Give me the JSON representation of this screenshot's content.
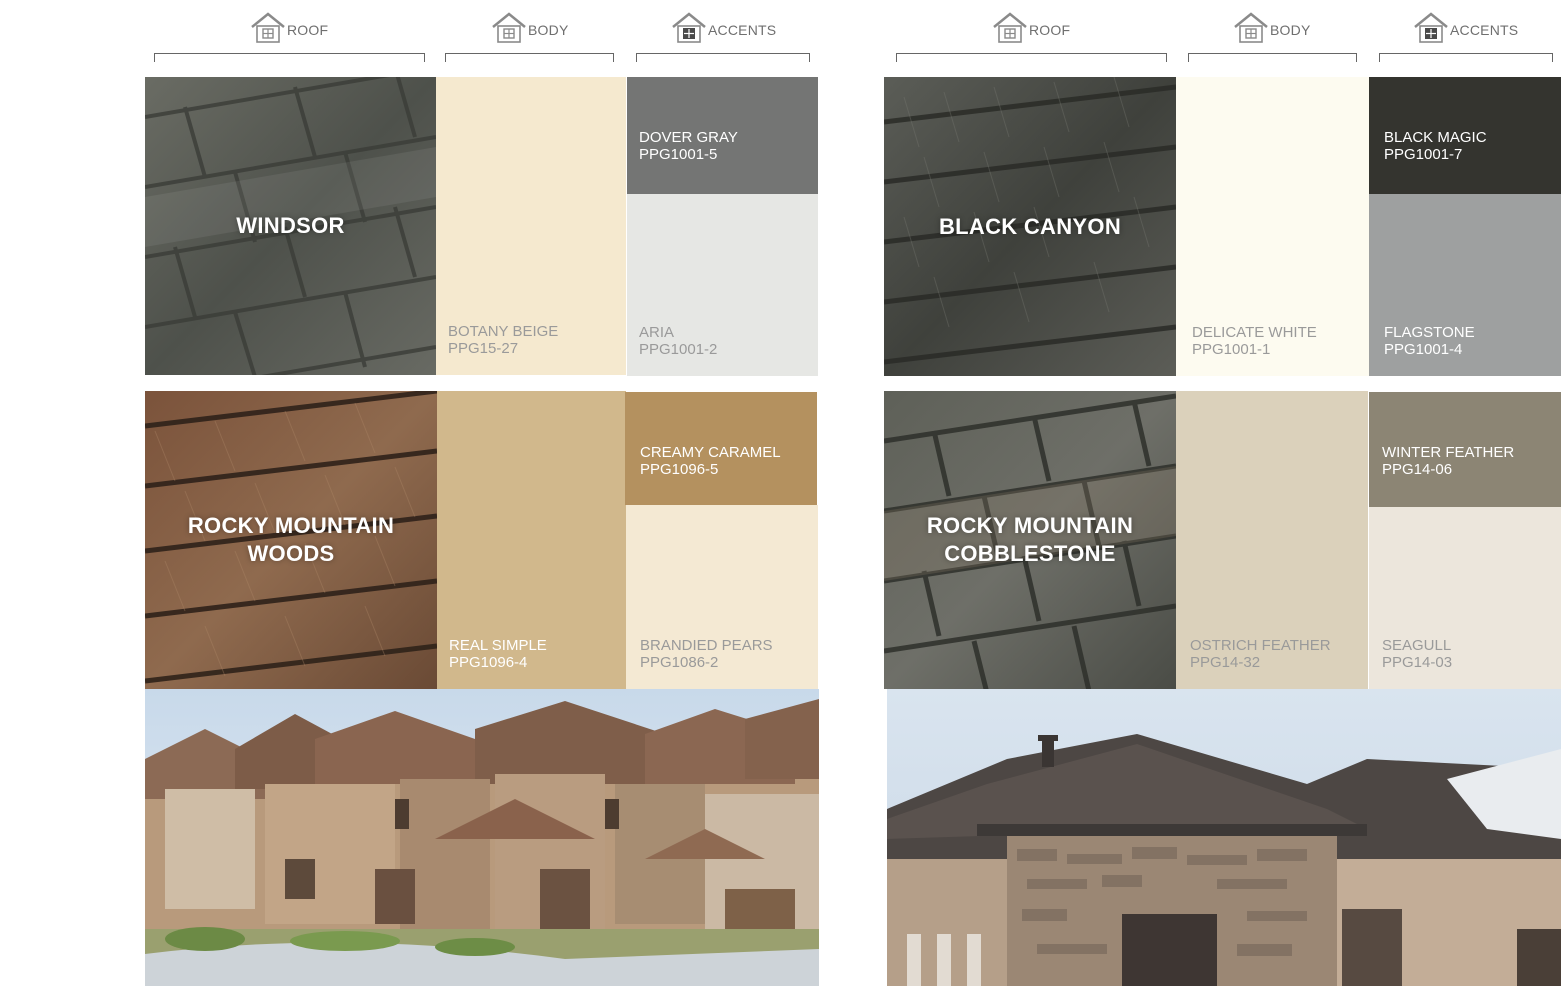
{
  "columns": {
    "roof": "ROOF",
    "body": "BODY",
    "accents": "ACCENTS"
  },
  "schemes": [
    {
      "roof": "WINDSOR",
      "body": {
        "name": "BOTANY BEIGE",
        "code": "PPG15-27",
        "color": "#f5e9cf"
      },
      "accent1": {
        "name": "DOVER GRAY",
        "code": "PPG1001-5",
        "color": "#747574"
      },
      "accent2": {
        "name": "ARIA",
        "code": "PPG1001-2",
        "color": "#e6e7e4"
      }
    },
    {
      "roof": "BLACK CANYON",
      "body": {
        "name": "DELICATE WHITE",
        "code": "PPG1001-1",
        "color": "#fdfbf0"
      },
      "accent1": {
        "name": "BLACK MAGIC",
        "code": "PPG1001-7",
        "color": "#34342f"
      },
      "accent2": {
        "name": "FLAGSTONE",
        "code": "PPG1001-4",
        "color": "#9ea0a0"
      }
    },
    {
      "roof": "ROCKY MOUNTAIN\nWOODS",
      "body": {
        "name": "REAL SIMPLE",
        "code": "PPG1096-4",
        "color": "#d1b88c"
      },
      "accent1": {
        "name": "CREAMY CARAMEL",
        "code": "PPG1096-5",
        "color": "#b4915f"
      },
      "accent2": {
        "name": "BRANDIED PEARS",
        "code": "PPG1086-2",
        "color": "#f4e9d3"
      }
    },
    {
      "roof": "ROCKY MOUNTAIN\nCOBBLESTONE",
      "body": {
        "name": "OSTRICH FEATHER",
        "code": "PPG14-32",
        "color": "#dbd1bb"
      },
      "accent1": {
        "name": "WINTER FEATHER",
        "code": "PPG14-06",
        "color": "#8c8574"
      },
      "accent2": {
        "name": "SEAGULL",
        "code": "PPG14-03",
        "color": "#ece6dc"
      }
    }
  ],
  "icons": {
    "column_icon": "house-icon",
    "house_photo": "house-photo"
  }
}
